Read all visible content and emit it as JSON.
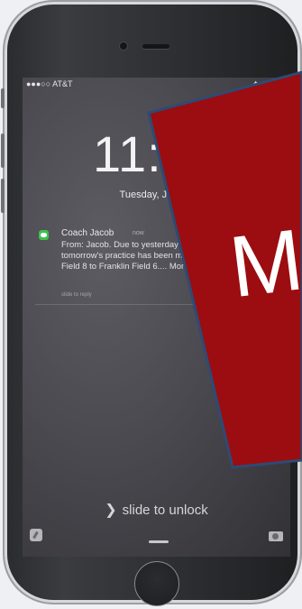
{
  "status_bar": {
    "carrier": "●●●○○ AT&T",
    "right_icons": "✦ ∗"
  },
  "lock_screen": {
    "time": "11:05",
    "date": "Tuesday, July 28"
  },
  "notification": {
    "app_icon": "messages-icon",
    "sender": "Coach Jacob",
    "time_ago": "now",
    "body": "From: Jacob. Due to yesterday's crazy storm, tomorrow's practice has been moved from Franklin Field 8 to Franklin Field 6.... More: http://goo.gl/9r4l2j",
    "action": "slide to reply"
  },
  "unlock": {
    "label": "slide to unlock",
    "chevron_icon": "chevron-right-icon"
  },
  "bottom_icons": {
    "left": "control-center-icon",
    "right": "camera-icon"
  },
  "overlay": {
    "text": "M",
    "fill_color": "#9b0d10",
    "border_color": "#2e4a74"
  }
}
